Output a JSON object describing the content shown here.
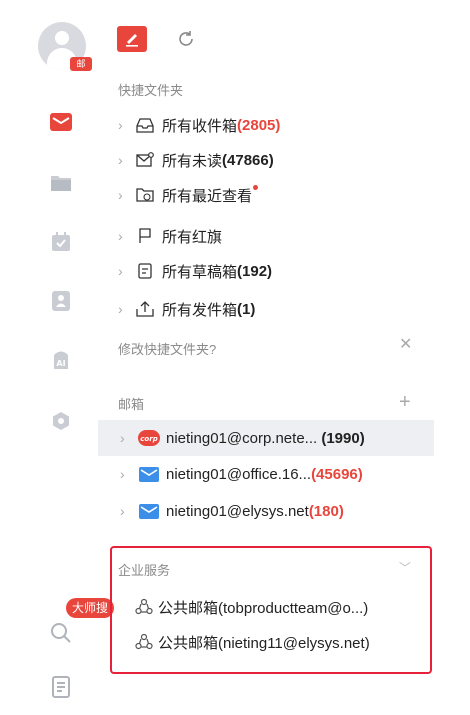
{
  "rail": {
    "avatar_badge": "邮",
    "master_tag": "大师搜"
  },
  "quick_folders": {
    "title": "快捷文件夹",
    "items": [
      {
        "label": "所有收件箱",
        "count": "(2805)",
        "icon": "inbox-icon",
        "count_color": "red"
      },
      {
        "label": "所有未读",
        "count": "(47866)",
        "icon": "unread-icon",
        "count_color": "dark"
      },
      {
        "label": "所有最近查看",
        "count": "",
        "icon": "recent-folder-icon",
        "has_dot": true
      },
      {
        "label": "所有红旗",
        "count": "",
        "icon": "flag-icon"
      },
      {
        "label": "所有草稿箱",
        "count": "(192)",
        "icon": "draft-icon",
        "count_color": "dark"
      },
      {
        "label": "所有发件箱",
        "count": "(1)",
        "icon": "outbox-icon",
        "count_color": "dark"
      }
    ],
    "edit_link": "修改快捷文件夹?"
  },
  "mailboxes": {
    "title": "邮箱",
    "items": [
      {
        "address": "nieting01@corp.nete...",
        "count": "(1990)",
        "icon": "corp-icon",
        "count_color": "dark",
        "selected": true
      },
      {
        "address": "nieting01@office.16...",
        "count": "(45696)",
        "icon": "mail-icon",
        "count_color": "red"
      },
      {
        "address": "nieting01@elysys.net",
        "count": "(180)",
        "icon": "mail-icon",
        "count_color": "red"
      }
    ]
  },
  "enterprise": {
    "title": "企业服务",
    "items": [
      {
        "label": "公共邮箱(tobproductteam@o...)",
        "icon": "public-mailbox-icon"
      },
      {
        "label": "公共邮箱(nieting11@elysys.net)",
        "icon": "public-mailbox-icon"
      }
    ]
  },
  "colors": {
    "accent": "#e8463c",
    "highlight_border": "#e8213a"
  }
}
